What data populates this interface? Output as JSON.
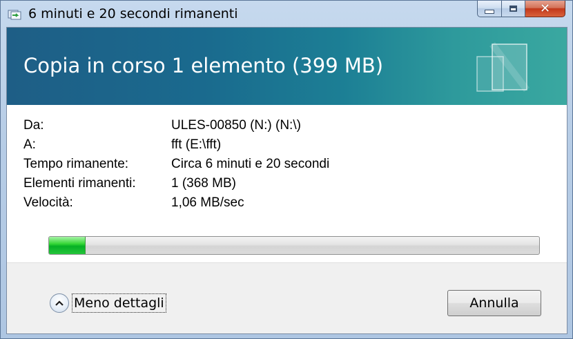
{
  "window": {
    "title": "6 minuti e 20 secondi rimanenti",
    "icon": "copy-files-icon",
    "caption_icons": [
      "minimize-icon",
      "maximize-icon",
      "close-icon"
    ],
    "close_glyph": "✕"
  },
  "banner": {
    "title": "Copia in corso 1 elemento (399 MB)",
    "graphic": "copy-documents-icon",
    "colors": {
      "left": "#1e5e86",
      "right": "#3aa8a0"
    }
  },
  "details": [
    {
      "label": "Da:",
      "value": "ULES-00850 (N:) (N:\\)"
    },
    {
      "label": "A:",
      "value": "fft (E:\\fft)"
    },
    {
      "label": "Tempo rimanente:",
      "value": "Circa 6 minuti e 20 secondi"
    },
    {
      "label": "Elementi rimanenti:",
      "value": "1 (368 MB)"
    },
    {
      "label": "Velocità:",
      "value": "1,06 MB/sec"
    }
  ],
  "progress": {
    "fraction": 0.075,
    "color": "#06b025"
  },
  "footer": {
    "toggle_label": "Meno dettagli",
    "toggle_icon": "chevron-up-icon",
    "cancel_label": "Annulla"
  }
}
